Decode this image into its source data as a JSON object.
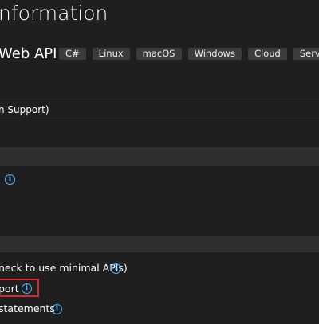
{
  "header": {
    "title": "nformation",
    "project_type": "Web API"
  },
  "tags": [
    "C#",
    "Linux",
    "macOS",
    "Windows",
    "Cloud",
    "Servic"
  ],
  "framework_field": {
    "value": "n Support)"
  },
  "options": {
    "minimal_api_label": "neck to use minimal APIs)",
    "aot_label": "port",
    "top_level_label": "statements"
  },
  "colors": {
    "background": "#1f1f1f",
    "section_band": "#2e2e2e",
    "tag_bg": "#3c3c3c",
    "info_icon": "#4cb7ff",
    "highlight": "#e0262d"
  },
  "icons": {
    "info": "info-circle-icon"
  }
}
